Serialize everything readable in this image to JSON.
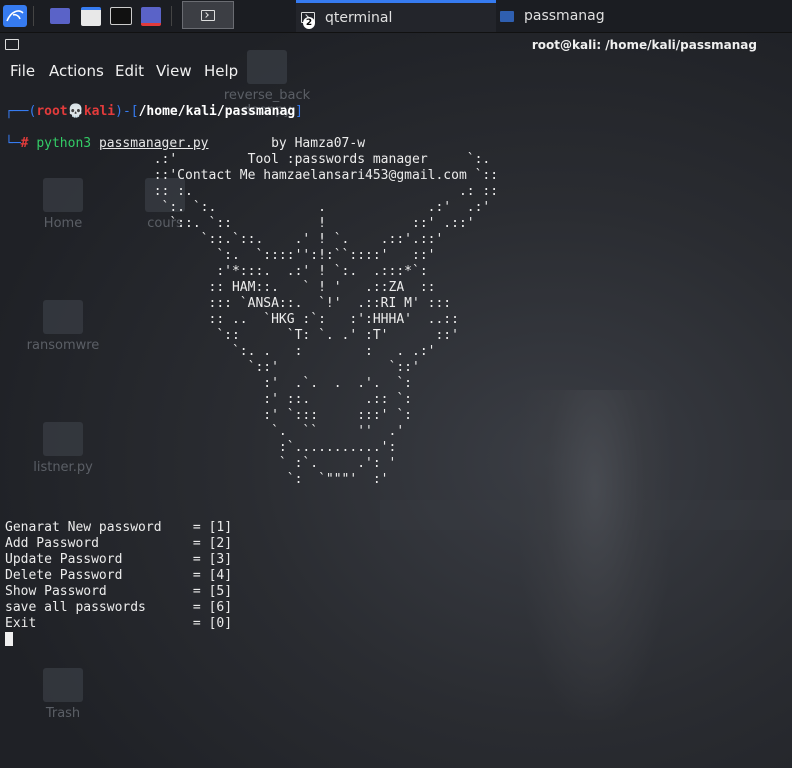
{
  "taskbar": {
    "tabs": [
      {
        "label": "qterminal",
        "badge": "2"
      },
      {
        "label": "passmanag"
      }
    ]
  },
  "window": {
    "title": "root@kali: /home/kali/passmanag"
  },
  "menubar": {
    "items": [
      "File",
      "Actions",
      "Edit",
      "View",
      "Help"
    ]
  },
  "desktop": {
    "icons": [
      {
        "label": "reverse_back door.py"
      },
      {
        "label": "Home"
      },
      {
        "label": "cours"
      },
      {
        "label": "ransomwre"
      },
      {
        "label": "listner.py"
      },
      {
        "label": "Trash"
      }
    ]
  },
  "prompt": {
    "user": "root",
    "host": "kali",
    "path": "/home/kali/passmanag",
    "symbol": "#",
    "command": "python3",
    "argument": "passmanager.py"
  },
  "banner": {
    "lines": [
      "                                  by Hamza07-w",
      "                   .:'         Tool :passwords manager     `:.",
      "                   ::'Contact Me hamzaelansari453@gmail.com `::",
      "                   :: :.                                  .: ::",
      "                    `:. `:.             .             .:'  .:'",
      "                     `::. `::           !           ::' .::'",
      "                         `::.`::.    .' ! `.    .::'.::'",
      "                           `:.  `::::'':!:``::::'   ::'",
      "                           :'*:::.  .:' ! `:.  .:::*`:",
      "                          :: HAM::.   ` ! '   .::ZA  ::",
      "                          ::: `ANSA::.  `!'  .::RI M' :::",
      "                          :: ..  `HKG :`:   :':HHHA'  ..::",
      "                           `::      `T: `. .' :T'      ::'",
      "                             `:. .   :        :   . .:'",
      "                               `::'              `::'",
      "                                 :'  .`.  .  .'.  `:",
      "                                 :' ::.       .:: `:",
      "                                 :' `:::     :::' `:",
      "                                  `.  ``     ''  .'",
      "                                   :`...........':",
      "                                   ` :`.     .': '",
      "                                    `:  `\"\"\"'  :'"
    ]
  },
  "options": [
    {
      "label": "Genarat New password",
      "key": "[1]"
    },
    {
      "label": "Add Password",
      "key": "[2]"
    },
    {
      "label": "Update Password",
      "key": "[3]"
    },
    {
      "label": "Delete Password",
      "key": "[4]"
    },
    {
      "label": "Show Password",
      "key": "[5]"
    },
    {
      "label": "save all passwords",
      "key": "[6]"
    },
    {
      "label": "Exit",
      "key": "[0]"
    }
  ]
}
